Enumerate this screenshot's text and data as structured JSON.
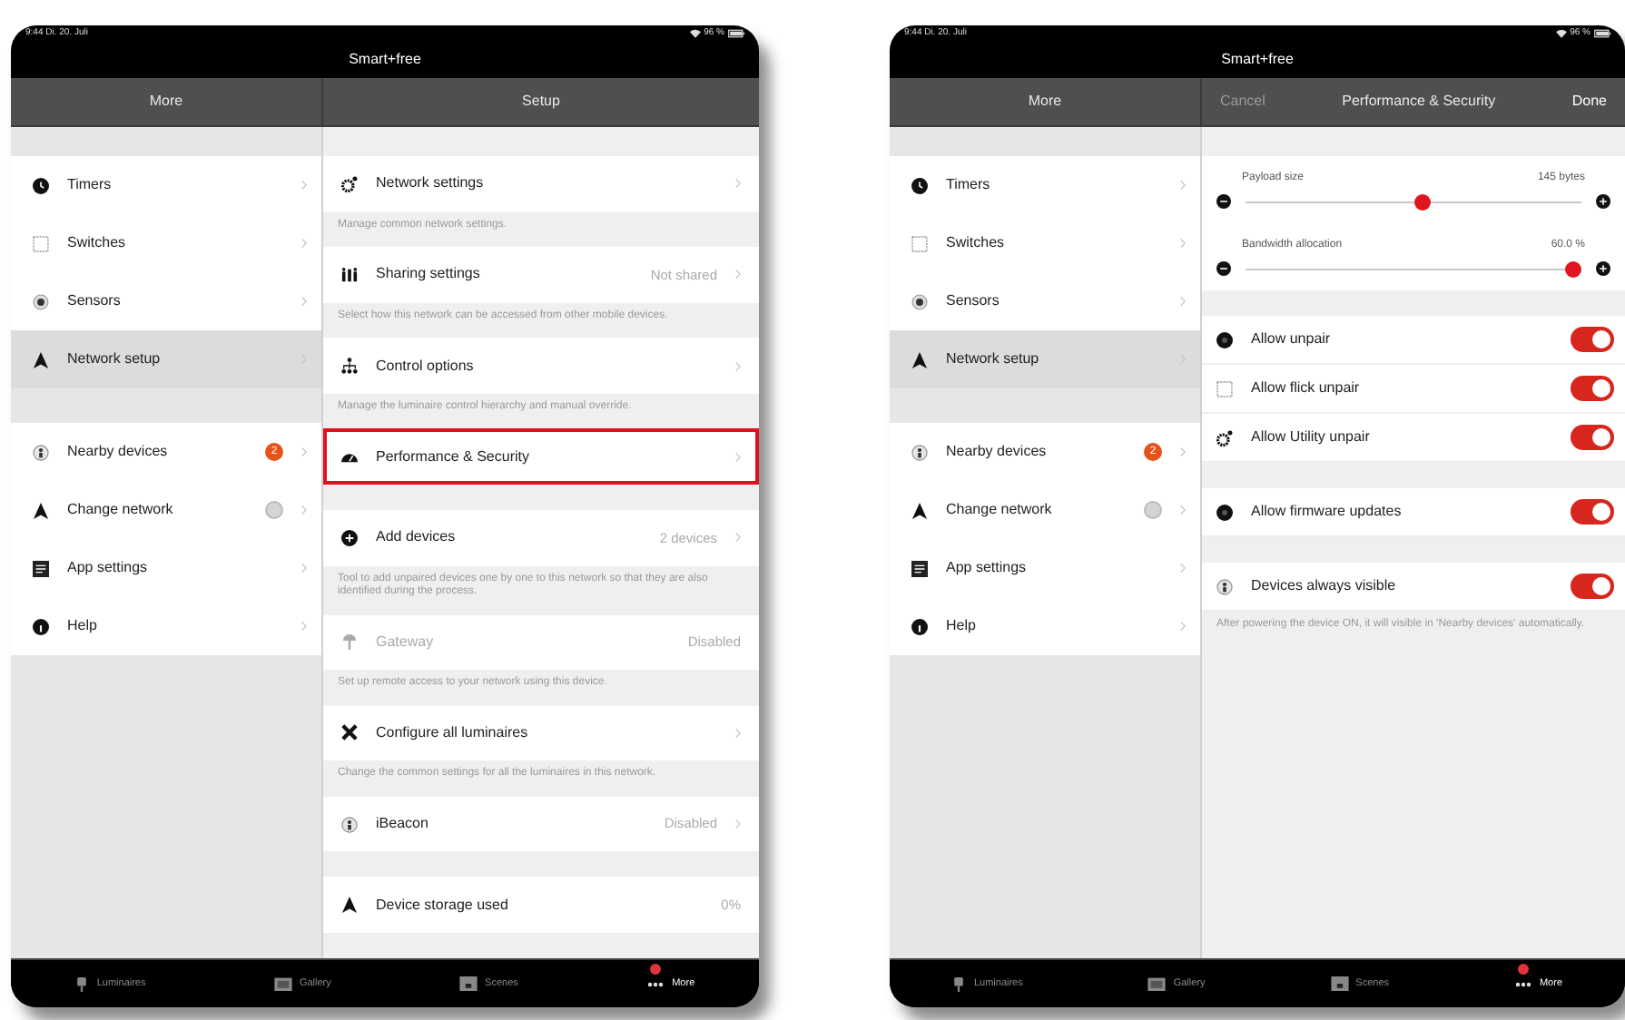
{
  "tablets": [
    {
      "status_bar": {
        "time": "9:44 Di. 20. Juli",
        "battery": "96 %"
      },
      "app_title": "Smart+free",
      "header": {
        "left_title": "More",
        "right_title": "Setup"
      },
      "menu_groups": [
        {
          "items": [
            {
              "label": "Timers",
              "selected": false
            },
            {
              "label": "Switches",
              "selected": false
            },
            {
              "label": "Sensors",
              "selected": false
            },
            {
              "label": "Network setup",
              "selected": true
            }
          ]
        },
        {
          "items": [
            {
              "label": "Nearby devices",
              "selected": false,
              "badge": {
                "kind": "count",
                "text": "2"
              }
            },
            {
              "label": "Change network",
              "selected": false,
              "badge": {
                "kind": "empty"
              }
            },
            {
              "label": "App settings",
              "selected": false
            },
            {
              "label": "Help",
              "selected": false
            }
          ]
        }
      ],
      "groups": [
        {
          "rows": [
            {
              "kind": "link",
              "label": "Network settings",
              "chevron": true,
              "disabled": false,
              "highlighted": false
            }
          ],
          "footer": "Manage common network settings."
        },
        {
          "rows": [
            {
              "kind": "link",
              "label": "Sharing settings",
              "value": "Not shared",
              "chevron": true,
              "disabled": false,
              "highlighted": false
            }
          ],
          "footer": "Select how this network can be accessed from other mobile devices."
        },
        {
          "rows": [
            {
              "kind": "link",
              "label": "Control options",
              "chevron": true,
              "disabled": false,
              "highlighted": false
            }
          ],
          "footer": "Manage the luminaire control hierarchy and manual override."
        },
        {
          "rows": [
            {
              "kind": "link",
              "label": "Performance & Security",
              "chevron": true,
              "disabled": false,
              "highlighted": true
            }
          ]
        },
        {
          "rows": [
            {
              "kind": "link",
              "label": "Add devices",
              "value": "2 devices",
              "chevron": true,
              "disabled": false,
              "highlighted": false
            }
          ],
          "footer": "Tool to add unpaired devices one by one to this network so that they are also identified during the process."
        },
        {
          "rows": [
            {
              "kind": "link",
              "label": "Gateway",
              "value": "Disabled",
              "chevron": false,
              "disabled": true,
              "highlighted": false
            }
          ],
          "footer": "Set up remote access to your network using this device."
        },
        {
          "rows": [
            {
              "kind": "link",
              "label": "Configure all luminaires",
              "chevron": true,
              "disabled": false,
              "highlighted": false
            }
          ],
          "footer": "Change the common settings for all the luminaires in this network."
        },
        {
          "rows": [
            {
              "kind": "link",
              "label": "iBeacon",
              "value": "Disabled",
              "chevron": true,
              "disabled": false,
              "highlighted": false
            }
          ]
        },
        {
          "rows": [
            {
              "kind": "link",
              "label": "Device storage used",
              "value": "0%",
              "chevron": false,
              "disabled": false,
              "highlighted": false
            }
          ]
        }
      ],
      "tab_bar": [
        {
          "label": "Luminaires",
          "selected": false,
          "dot": false
        },
        {
          "label": "Gallery",
          "selected": false,
          "dot": false
        },
        {
          "label": "Scenes",
          "selected": false,
          "dot": false
        },
        {
          "label": "More",
          "selected": true,
          "dot": true
        }
      ]
    },
    {
      "status_bar": {
        "time": "9:44 Di. 20. Juli",
        "battery": "96 %"
      },
      "app_title": "Smart+free",
      "header": {
        "left_title": "More",
        "cancel": "Cancel",
        "right_title": "Performance & Security",
        "done": "Done"
      },
      "menu_groups": [
        {
          "items": [
            {
              "label": "Timers",
              "selected": false
            },
            {
              "label": "Switches",
              "selected": false
            },
            {
              "label": "Sensors",
              "selected": false
            },
            {
              "label": "Network setup",
              "selected": true
            }
          ]
        },
        {
          "items": [
            {
              "label": "Nearby devices",
              "selected": false,
              "badge": {
                "kind": "count",
                "text": "2"
              }
            },
            {
              "label": "Change network",
              "selected": false,
              "badge": {
                "kind": "empty"
              }
            },
            {
              "label": "App settings",
              "selected": false
            },
            {
              "label": "Help",
              "selected": false
            }
          ]
        }
      ],
      "groups": [
        {
          "rows": [
            {
              "kind": "slider",
              "label": "Payload size",
              "reading": "145 bytes",
              "level": 0.53
            },
            {
              "kind": "slider",
              "label": "Bandwidth allocation",
              "reading": "60.0 %",
              "level": 1
            }
          ]
        },
        {
          "rows": [
            {
              "kind": "toggle",
              "label": "Allow unpair",
              "on": true
            },
            {
              "kind": "toggle",
              "label": "Allow flick unpair",
              "on": true
            },
            {
              "kind": "toggle",
              "label": "Allow Utility unpair",
              "on": true
            }
          ]
        },
        {
          "rows": [
            {
              "kind": "toggle",
              "label": "Allow firmware updates",
              "on": true
            }
          ]
        },
        {
          "rows": [
            {
              "kind": "toggle",
              "label": "Devices always visible",
              "on": true
            }
          ],
          "footer": "After powering the device ON, it will visible in 'Nearby devices' automatically."
        }
      ],
      "tab_bar": [
        {
          "label": "Luminaires",
          "selected": false,
          "dot": false
        },
        {
          "label": "Gallery",
          "selected": false,
          "dot": false
        },
        {
          "label": "Scenes",
          "selected": false,
          "dot": false
        },
        {
          "label": "More",
          "selected": true,
          "dot": true
        }
      ]
    }
  ]
}
